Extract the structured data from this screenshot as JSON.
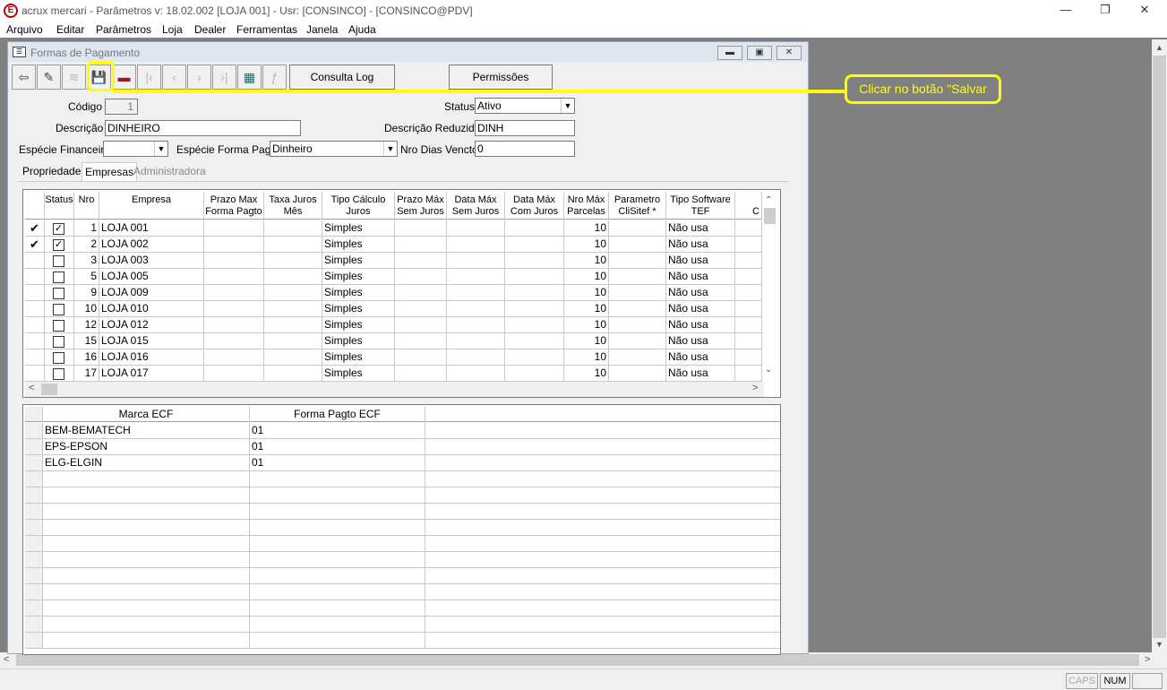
{
  "app": {
    "title": "acrux mercari - Parâmetros  v: 18.02.002  [LOJA 001] - Usr: [CONSINCO] - [CONSINCO@PDV]",
    "icon_letter": "E",
    "menu": [
      "Arquivo",
      "Editar",
      "Parâmetros",
      "Loja",
      "Dealer",
      "Ferramentas",
      "Janela",
      "Ajuda"
    ]
  },
  "form": {
    "title": "Formas de Pagamento",
    "toolbar": {
      "consulta_log": "Consulta Log",
      "permissoes": "Permissões"
    },
    "fields": {
      "codigo_label": "Código",
      "codigo_value": "1",
      "status_label": "Status",
      "status_value": "Ativo",
      "descricao_label": "Descrição",
      "descricao_value": "DINHEIRO",
      "descricao_reduzida_label": "Descrição Reduzida",
      "descricao_reduzida_value": "DINH",
      "especie_financeira_label": "Espécie Financeira",
      "especie_financeira_value": "",
      "especie_forma_pagto_label": "Espécie Forma Pagto",
      "especie_forma_pagto_value": "Dinheiro",
      "nro_dias_vencto_label": "Nro Dias Vencto",
      "nro_dias_vencto_value": "0"
    },
    "tabs": [
      "Propriedades",
      "Empresas",
      "Administradora"
    ],
    "active_tab": "Empresas",
    "empresas_grid": {
      "headers": [
        "Status",
        "Nro",
        "Empresa",
        "Prazo Max\nForma Pagto",
        "Taxa Juros\nMês",
        "Tipo Cálculo\nJuros",
        "Prazo Máx\nSem Juros",
        "Data Máx\nSem Juros",
        "Data Máx\nCom Juros",
        "Nro Máx\nParcelas",
        "Parametro\nCliSitef *",
        "Tipo Software\nTEF",
        "C"
      ],
      "rows": [
        {
          "marked": true,
          "checked": true,
          "nro": "1",
          "empresa": "LOJA 001",
          "tipo": "Simples",
          "parcelas": "10",
          "tef": "Não usa"
        },
        {
          "marked": true,
          "checked": true,
          "nro": "2",
          "empresa": "LOJA 002",
          "tipo": "Simples",
          "parcelas": "10",
          "tef": "Não usa"
        },
        {
          "marked": false,
          "checked": false,
          "nro": "3",
          "empresa": "LOJA 003",
          "tipo": "Simples",
          "parcelas": "10",
          "tef": "Não usa"
        },
        {
          "marked": false,
          "checked": false,
          "nro": "5",
          "empresa": "LOJA 005",
          "tipo": "Simples",
          "parcelas": "10",
          "tef": "Não usa"
        },
        {
          "marked": false,
          "checked": false,
          "nro": "9",
          "empresa": "LOJA 009",
          "tipo": "Simples",
          "parcelas": "10",
          "tef": "Não usa"
        },
        {
          "marked": false,
          "checked": false,
          "nro": "10",
          "empresa": "LOJA 010",
          "tipo": "Simples",
          "parcelas": "10",
          "tef": "Não usa"
        },
        {
          "marked": false,
          "checked": false,
          "nro": "12",
          "empresa": "LOJA 012",
          "tipo": "Simples",
          "parcelas": "10",
          "tef": "Não usa"
        },
        {
          "marked": false,
          "checked": false,
          "nro": "15",
          "empresa": "LOJA 015",
          "tipo": "Simples",
          "parcelas": "10",
          "tef": "Não usa"
        },
        {
          "marked": false,
          "checked": false,
          "nro": "16",
          "empresa": "LOJA 016",
          "tipo": "Simples",
          "parcelas": "10",
          "tef": "Não usa"
        },
        {
          "marked": false,
          "checked": false,
          "nro": "17",
          "empresa": "LOJA 017",
          "tipo": "Simples",
          "parcelas": "10",
          "tef": "Não usa"
        }
      ]
    },
    "ecf_grid": {
      "headers": [
        "Marca ECF",
        "Forma Pagto ECF"
      ],
      "rows": [
        {
          "marca": "BEM-BEMATECH",
          "forma": "01"
        },
        {
          "marca": "EPS-EPSON",
          "forma": "01"
        },
        {
          "marca": "ELG-ELGIN",
          "forma": "01"
        }
      ]
    }
  },
  "annotation": {
    "callout_text": "Clicar no botão \"Salvar",
    "color": "#ffff00"
  },
  "statusbar": {
    "caps": "CAPS",
    "num": "NUM"
  }
}
